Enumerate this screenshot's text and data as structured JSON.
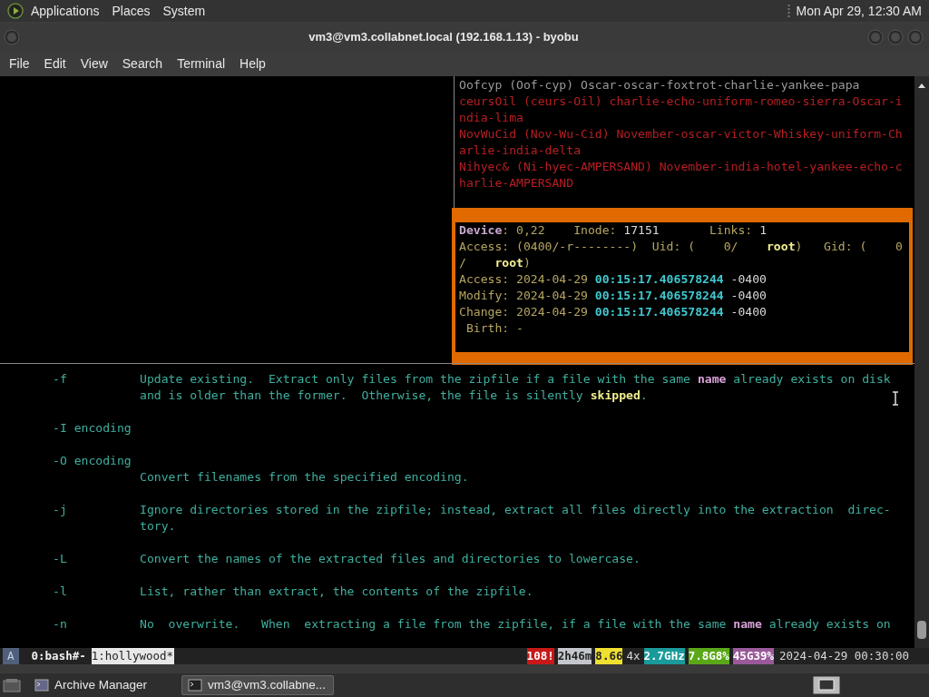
{
  "top_panel": {
    "menus": [
      "Applications",
      "Places",
      "System"
    ],
    "clock": "Mon Apr 29, 12:30 AM"
  },
  "window": {
    "title": "vm3@vm3.collabnet.local (192.168.1.13) - byobu"
  },
  "menu_bar": [
    "File",
    "Edit",
    "View",
    "Search",
    "Terminal",
    "Help"
  ],
  "upper_right_pane": {
    "lines": [
      [
        {
          "kind": "grey",
          "text": "Oofcyp (Oof-cyp) Oscar-oscar-foxtrot-charlie-yankee-papa"
        }
      ],
      [
        {
          "kind": "red",
          "text": "ceursOil (ceurs-Oil) charlie-echo-uniform-romeo-sierra-Oscar-i"
        }
      ],
      [
        {
          "kind": "red",
          "text": "ndia-lima"
        }
      ],
      [
        {
          "kind": "red",
          "text": "NovWuCid (Nov-Wu-Cid) November-oscar-victor-Whiskey-uniform-Ch"
        }
      ],
      [
        {
          "kind": "red",
          "text": "arlie-india-delta"
        }
      ],
      [
        {
          "kind": "red",
          "text": "Nihyec& (Ni-hyec-AMPERSAND) November-india-hotel-yankee-echo-c"
        }
      ],
      [
        {
          "kind": "red",
          "text": "harlie-AMPERSAND"
        }
      ]
    ]
  },
  "stat_box": {
    "lines": [
      [
        {
          "kind": "label",
          "text": "Device"
        },
        {
          "kind": "olive",
          "text": ": 0,22    Inode: "
        },
        {
          "kind": "value",
          "text": "17151"
        },
        {
          "kind": "olive",
          "text": "       Links: "
        },
        {
          "kind": "value",
          "text": "1"
        }
      ],
      [
        {
          "kind": "olive",
          "text": "Access: (0400/-r--------)  Uid: (    0/    "
        },
        {
          "kind": "bold-yellow",
          "text": "root"
        },
        {
          "kind": "olive",
          "text": ")   Gid: (    0"
        }
      ],
      [
        {
          "kind": "olive",
          "text": "/    "
        },
        {
          "kind": "bold-yellow",
          "text": "root"
        },
        {
          "kind": "olive",
          "text": ")"
        }
      ],
      [
        {
          "kind": "olive",
          "text": "Access: 2024-04-29 "
        },
        {
          "kind": "bold-cyan",
          "text": "00:15:17.406578244"
        },
        {
          "kind": "value",
          "text": " -0400"
        }
      ],
      [
        {
          "kind": "olive",
          "text": "Modify: 2024-04-29 "
        },
        {
          "kind": "bold-cyan",
          "text": "00:15:17.406578244"
        },
        {
          "kind": "value",
          "text": " -0400"
        }
      ],
      [
        {
          "kind": "olive",
          "text": "Change: 2024-04-29 "
        },
        {
          "kind": "bold-cyan",
          "text": "00:15:17.406578244"
        },
        {
          "kind": "value",
          "text": " -0400"
        }
      ],
      [
        {
          "kind": "olive",
          "text": " Birth: -"
        }
      ]
    ]
  },
  "man_page": {
    "entries": [
      {
        "rows": [
          {
            "flag": "-f",
            "segments": [
              {
                "kind": "teal",
                "text": "Update existing.  Extract only files from the zipfile if a file with the same "
              },
              {
                "kind": "bold-pink",
                "text": "name"
              },
              {
                "kind": "teal",
                "text": " already exists on disk"
              }
            ]
          },
          {
            "segments": [
              {
                "kind": "teal",
                "text": "and is older than the former.  Otherwise, the file is silently "
              },
              {
                "kind": "bold-yellow",
                "text": "skipped"
              },
              {
                "kind": "teal",
                "text": "."
              }
            ]
          }
        ]
      },
      {
        "rows": [
          {
            "flag": "-I encoding"
          }
        ]
      },
      {
        "rows": [
          {
            "flag": "-O encoding"
          },
          {
            "segments": [
              {
                "kind": "teal",
                "text": "Convert filenames from the specified encoding."
              }
            ]
          }
        ]
      },
      {
        "rows": [
          {
            "flag": "-j",
            "segments": [
              {
                "kind": "teal",
                "text": "Ignore directories stored in the zipfile; instead, extract all files directly into the extraction  direc-"
              }
            ]
          },
          {
            "segments": [
              {
                "kind": "teal",
                "text": "tory."
              }
            ]
          }
        ]
      },
      {
        "rows": [
          {
            "flag": "-L",
            "segments": [
              {
                "kind": "teal",
                "text": "Convert the names of the extracted files and directories to lowercase."
              }
            ]
          }
        ]
      },
      {
        "rows": [
          {
            "flag": "-l",
            "segments": [
              {
                "kind": "teal",
                "text": "List, rather than extract, the contents of the zipfile."
              }
            ]
          }
        ]
      },
      {
        "rows": [
          {
            "flag": "-n",
            "segments": [
              {
                "kind": "teal",
                "text": "No  overwrite.   When  extracting a file from the zipfile, if a file with the same "
              },
              {
                "kind": "bold-pink",
                "text": "name"
              },
              {
                "kind": "teal",
                "text": " already exists on"
              }
            ]
          }
        ]
      }
    ]
  },
  "status_bar": {
    "mode": "A",
    "windows": [
      {
        "label": "0:bash#-",
        "selected": false
      },
      {
        "label": "1:hollywood*",
        "selected": true
      }
    ],
    "indicators": [
      {
        "text": "108!",
        "color": "#c81818"
      },
      {
        "text": "2h46m",
        "color": "#c4c8cc"
      },
      {
        "text": "8.66",
        "color": "#f0e030"
      },
      {
        "text": "4x"
      },
      {
        "text": "2.7GHz",
        "color": "#1a9a9a"
      },
      {
        "text": "7.8G8%",
        "color": "#5aa818"
      },
      {
        "text": "45G39%",
        "color": "#9a5a9a"
      }
    ],
    "datetime": "2024-04-29 00:30:00"
  },
  "taskbar": {
    "tasks": [
      {
        "label": "Archive Manager",
        "selected": false
      },
      {
        "label": "vm3@vm3.collabne...",
        "selected": true
      }
    ]
  }
}
